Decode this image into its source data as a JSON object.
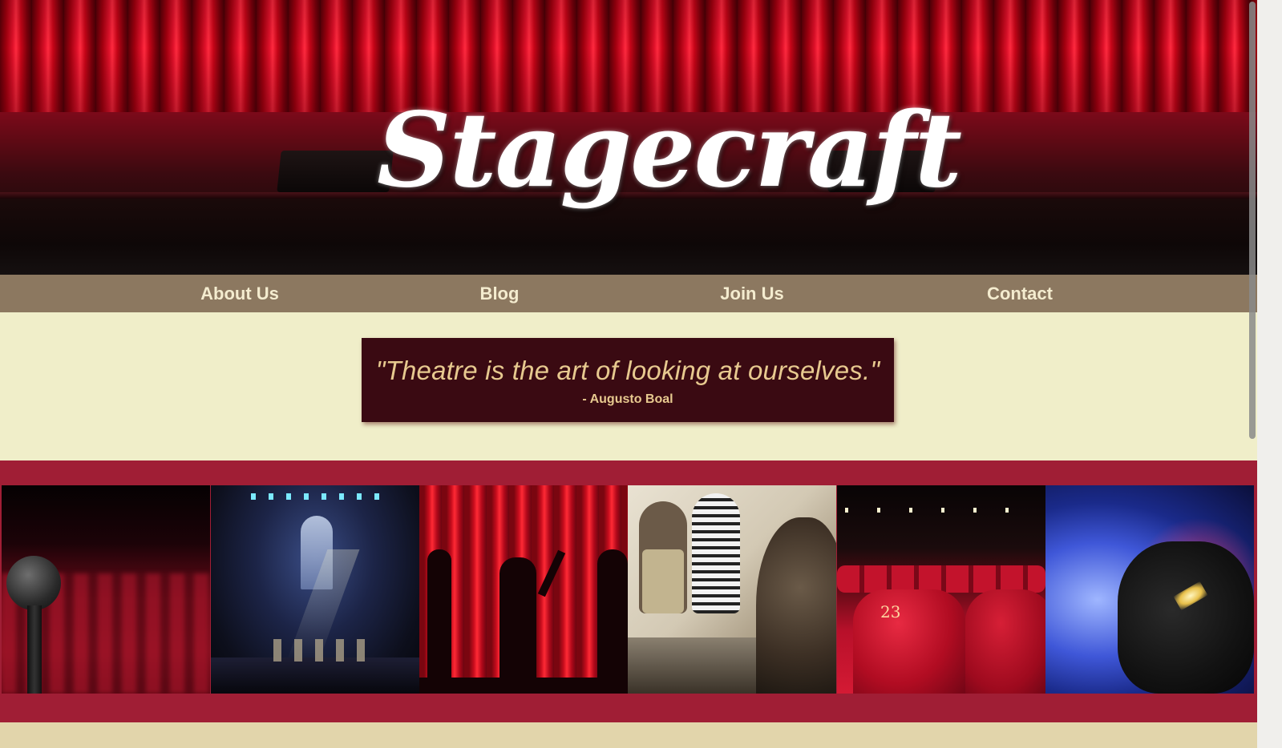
{
  "brand": {
    "logo_text": "Stagecraft"
  },
  "nav": {
    "items": [
      {
        "label": "About Us"
      },
      {
        "label": "Blog"
      },
      {
        "label": "Join Us"
      },
      {
        "label": "Contact"
      }
    ]
  },
  "quote": {
    "text": "\"Theatre is the art of looking at ourselves.\"",
    "author": "- Augusto Boal"
  },
  "gallery": {
    "images": [
      {
        "subject": "microphone-over-theatre-seats"
      },
      {
        "subject": "blue-lit-stage-set"
      },
      {
        "subject": "red-curtain-silhouettes"
      },
      {
        "subject": "backstage-makeup-room"
      },
      {
        "subject": "red-velvet-seats-23",
        "seat_number": "23"
      },
      {
        "subject": "stage-spotlight"
      }
    ]
  },
  "colors": {
    "nav_bg": "#8c7860",
    "nav_text": "#f4eccf",
    "quote_bg": "#3a0a12",
    "quote_text": "#e7c98f",
    "section_bg": "#f0eec9",
    "gallery_band": "#a01e35"
  }
}
